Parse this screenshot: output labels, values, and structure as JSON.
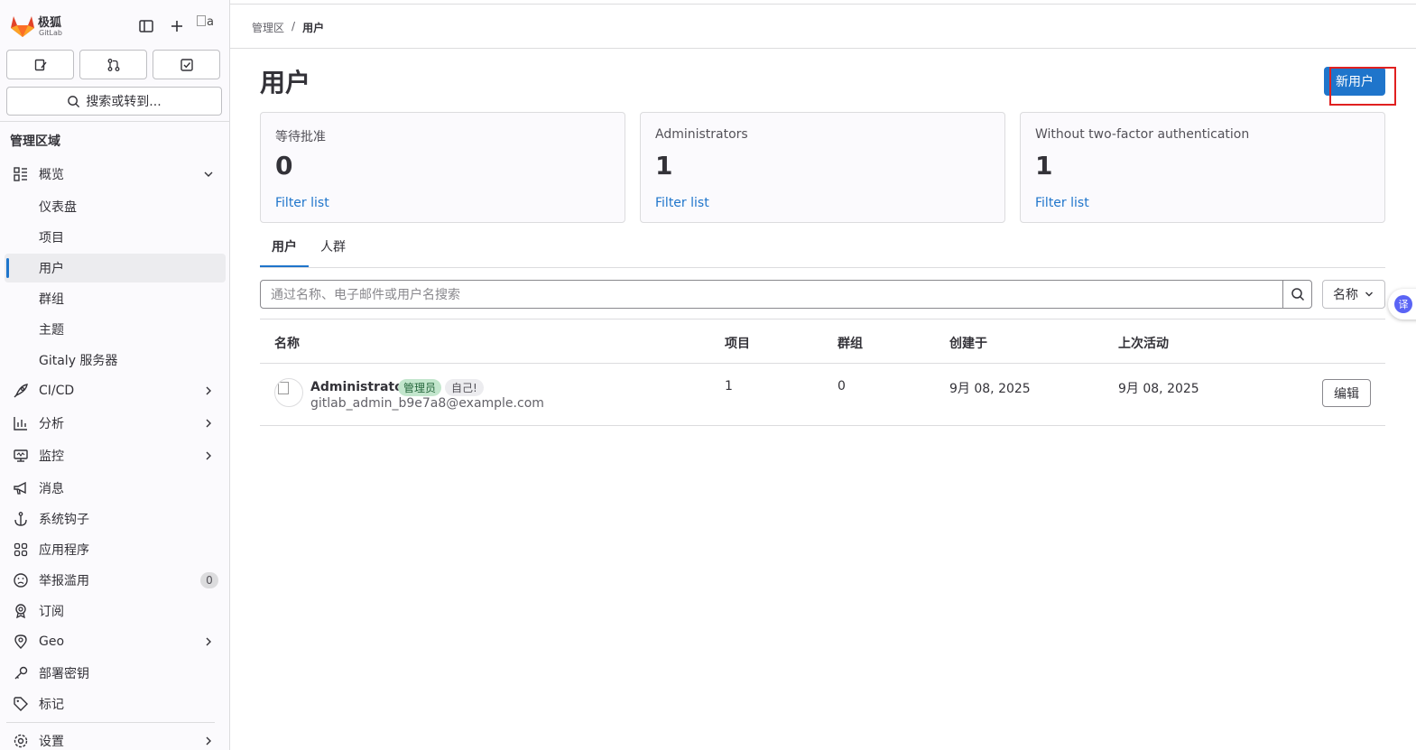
{
  "sidebar": {
    "brand": "极狐",
    "brand_sub": "GitLab",
    "avatar_alt": "a",
    "search_label": "搜索或转到...",
    "section_title": "管理区域",
    "nav": [
      {
        "label": "概览",
        "icon": "overview-icon"
      },
      {
        "label": "仪表盘"
      },
      {
        "label": "项目"
      },
      {
        "label": "用户"
      },
      {
        "label": "群组"
      },
      {
        "label": "主题"
      },
      {
        "label": "Gitaly 服务器"
      },
      {
        "label": "CI/CD",
        "icon": "rocket-icon"
      },
      {
        "label": "分析",
        "icon": "chart-icon"
      },
      {
        "label": "监控",
        "icon": "monitor-icon"
      },
      {
        "label": "消息",
        "icon": "bullhorn-icon"
      },
      {
        "label": "系统钩子",
        "icon": "anchor-icon"
      },
      {
        "label": "应用程序",
        "icon": "applications-icon"
      },
      {
        "label": "举报滥用",
        "icon": "abuse-icon",
        "count": "0"
      },
      {
        "label": "订阅",
        "icon": "subscription-icon"
      },
      {
        "label": "Geo",
        "icon": "location-icon"
      },
      {
        "label": "部署密钥",
        "icon": "key-icon"
      },
      {
        "label": "标记",
        "icon": "label-icon"
      },
      {
        "label": "设置",
        "icon": "settings-icon"
      }
    ]
  },
  "breadcrumb": {
    "root": "管理区",
    "sep": "/",
    "current": "用户"
  },
  "page": {
    "title": "用户",
    "new_user_label": "新用户"
  },
  "stats": [
    {
      "title": "等待批准",
      "value": "0",
      "link": "Filter list"
    },
    {
      "title": "Administrators",
      "value": "1",
      "link": "Filter list"
    },
    {
      "title": "Without two-factor authentication",
      "value": "1",
      "link": "Filter list"
    }
  ],
  "tabs": [
    {
      "label": "用户"
    },
    {
      "label": "人群"
    }
  ],
  "filter": {
    "placeholder": "通过名称、电子邮件或用户名搜索",
    "sort_label": "名称"
  },
  "table": {
    "headers": [
      "名称",
      "项目",
      "群组",
      "创建于",
      "上次活动"
    ],
    "rows": [
      {
        "name": "Administrator",
        "badge_admin": "管理员",
        "badge_self": "自己!",
        "email": "gitlab_admin_b9e7a8@example.com",
        "projects": "1",
        "groups": "0",
        "created": "9月 08, 2025",
        "last_activity": "9月 08, 2025",
        "edit_label": "编辑"
      }
    ]
  },
  "translate_fab": "译",
  "colors": {
    "accent": "#1f75cb",
    "highlight_box": "#e02020"
  }
}
